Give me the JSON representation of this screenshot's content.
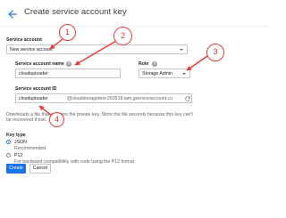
{
  "header": {
    "title": "Create service account key",
    "back_icon": "arrow-left-icon"
  },
  "service_account": {
    "label": "Service account",
    "selected": "New service account"
  },
  "name_field": {
    "label": "Service account name",
    "value": "cloudupioader"
  },
  "role_field": {
    "label": "Role",
    "selected": "Storage Admin"
  },
  "id_field": {
    "label": "Service account ID",
    "value": "cloudupioader",
    "suffix": "@cloudstoragetest-263518.iam.gserviceaccount.co",
    "refresh_icon": "refresh-icon"
  },
  "download_note": {
    "line1": "Downloads a file that contains the private key. Store the file securely because this key can't",
    "line2": "be recovered if lost."
  },
  "key_type": {
    "label": "Key type",
    "options": [
      {
        "label": "JSON",
        "sub": "Recommended",
        "selected": true
      },
      {
        "label": "P12",
        "sub": "For backward compatibility with code using the P12 format",
        "selected": false
      }
    ]
  },
  "actions": {
    "create_label": "Create",
    "cancel_label": "Cancel"
  },
  "annotations": [
    "1",
    "2",
    "3",
    "4"
  ],
  "colors": {
    "primary": "#1a73e8",
    "annotation": "#e53935",
    "border": "#c4c4c4",
    "help_icon": "#9aa0a6"
  }
}
